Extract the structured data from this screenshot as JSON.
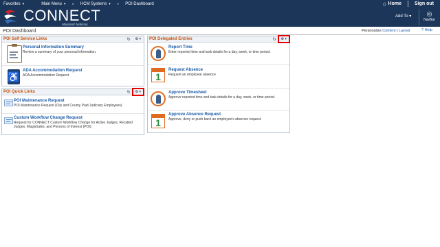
{
  "topnav": {
    "favorites": "Favorites",
    "main_menu": "Main Menu",
    "hcm_systems": "HCM Systems",
    "breadcrumb_sep": "▸",
    "current": "POI Dashboard",
    "home": "Home",
    "sign_out": "Sign out"
  },
  "banner": {
    "logo": "CONNECT",
    "logo_sub": "Maryland Judiciary",
    "add_to": "Add To",
    "navbar": "NavBar"
  },
  "header": {
    "page_title": "POI Dashboard",
    "personalize_prefix": "Personalize",
    "content": "Content",
    "separator": "|",
    "layout": "Layout",
    "help": "Help"
  },
  "self_service": {
    "title": "POI Self Service Links",
    "items": [
      {
        "title": "Personal Information Summary",
        "desc": "Review a summary of your personal information.",
        "icon": "clipboard-icon"
      },
      {
        "title": "ADA Accommodation Request",
        "desc": "ADA Accommodation Request",
        "icon": "wheelchair-icon"
      }
    ]
  },
  "quick_links": {
    "title": "POI Quick Links",
    "items": [
      {
        "title": "POI Maintenance Request",
        "desc": "POI Maintenance Request (City and County Paid Judiciary Employees)",
        "icon": "form-icon"
      },
      {
        "title": "Custom Workflow Change Request",
        "desc": "Request for CONNECT Custom Workflow Change for Active Judges, Recalled Judges, Magistrates, and Persons of Interest (POI).",
        "icon": "form-icon"
      }
    ]
  },
  "delegated": {
    "title": "POI Delegated Entries",
    "items": [
      {
        "title": "Report Time",
        "desc": "Enter reported time and task details for a day, week, or time period.",
        "icon": "person-clock-icon"
      },
      {
        "title": "Request Absence",
        "desc": "Request an employee absence",
        "icon": "calendar-icon",
        "cal_num": "1"
      },
      {
        "title": "Approve Timesheet",
        "desc": "Approve reported time and task details for a day, week, or time period.",
        "icon": "person-clock-icon"
      },
      {
        "title": "Approve Absence Request",
        "desc": "Approve, deny or push back an employee's absence request.",
        "icon": "calendar-icon",
        "cal_num": "1"
      }
    ]
  },
  "glyphs": {
    "refresh": "↻",
    "gear": "⚙ ▾",
    "home": "⌂",
    "caret": "▾",
    "navbar": "◎",
    "wheelchair": "♿"
  },
  "colors": {
    "banner": "#1c3659",
    "pagelet_title": "#c0510e",
    "link": "#1a5aa6",
    "highlight": "#e60000"
  }
}
